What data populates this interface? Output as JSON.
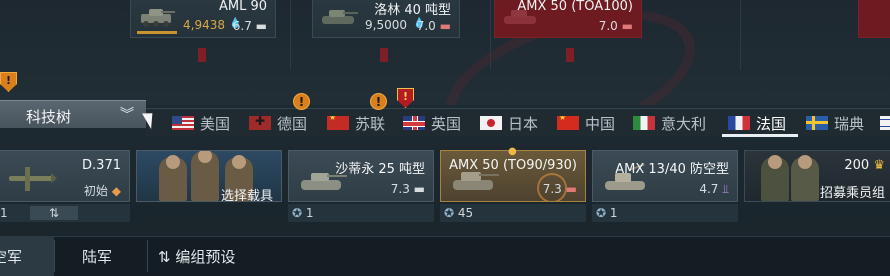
{
  "tree": {
    "cards": [
      {
        "name": "AML 90",
        "price": "4,9438",
        "br": "6.7"
      },
      {
        "name": "洛林 40 吨型",
        "price": "9,5000",
        "br": "7.0"
      },
      {
        "name": "AMX 50 (TOA100)",
        "br": "7.0"
      }
    ]
  },
  "tech_tree_button": {
    "label": "科技树"
  },
  "nations": [
    {
      "label": "美国",
      "flag": "us"
    },
    {
      "label": "德国",
      "flag": "de"
    },
    {
      "label": "苏联",
      "flag": "su"
    },
    {
      "label": "英国",
      "flag": "uk"
    },
    {
      "label": "日本",
      "flag": "jp"
    },
    {
      "label": "中国",
      "flag": "cn"
    },
    {
      "label": "意大利",
      "flag": "it"
    },
    {
      "label": "法国",
      "flag": "fr",
      "active": true
    },
    {
      "label": "瑞典",
      "flag": "se"
    }
  ],
  "slots": [
    {
      "name": "D.371",
      "sub": "初始",
      "footer": "1",
      "footer_icon": "⇅"
    },
    {
      "name": "选择载具"
    },
    {
      "name": "沙蒂永 25 吨型",
      "br": "7.3",
      "footer": "1"
    },
    {
      "name": "AMX 50 (TO90/930)",
      "br": "7.3",
      "footer": "45"
    },
    {
      "name": "AMX 13/40 防空型",
      "br": "4.7",
      "footer": "1"
    },
    {
      "name": "招募乘员组",
      "cost": "200"
    }
  ],
  "bottom": {
    "tabs": [
      "空军",
      "陆军"
    ],
    "preset": "编组预设",
    "preset_icon": "⇅"
  },
  "colors": {
    "accent_gold": "#c7942d",
    "warning_orange": "#d97f1c",
    "research_red": "#6d1a20",
    "active_tab": "#ffffff"
  }
}
